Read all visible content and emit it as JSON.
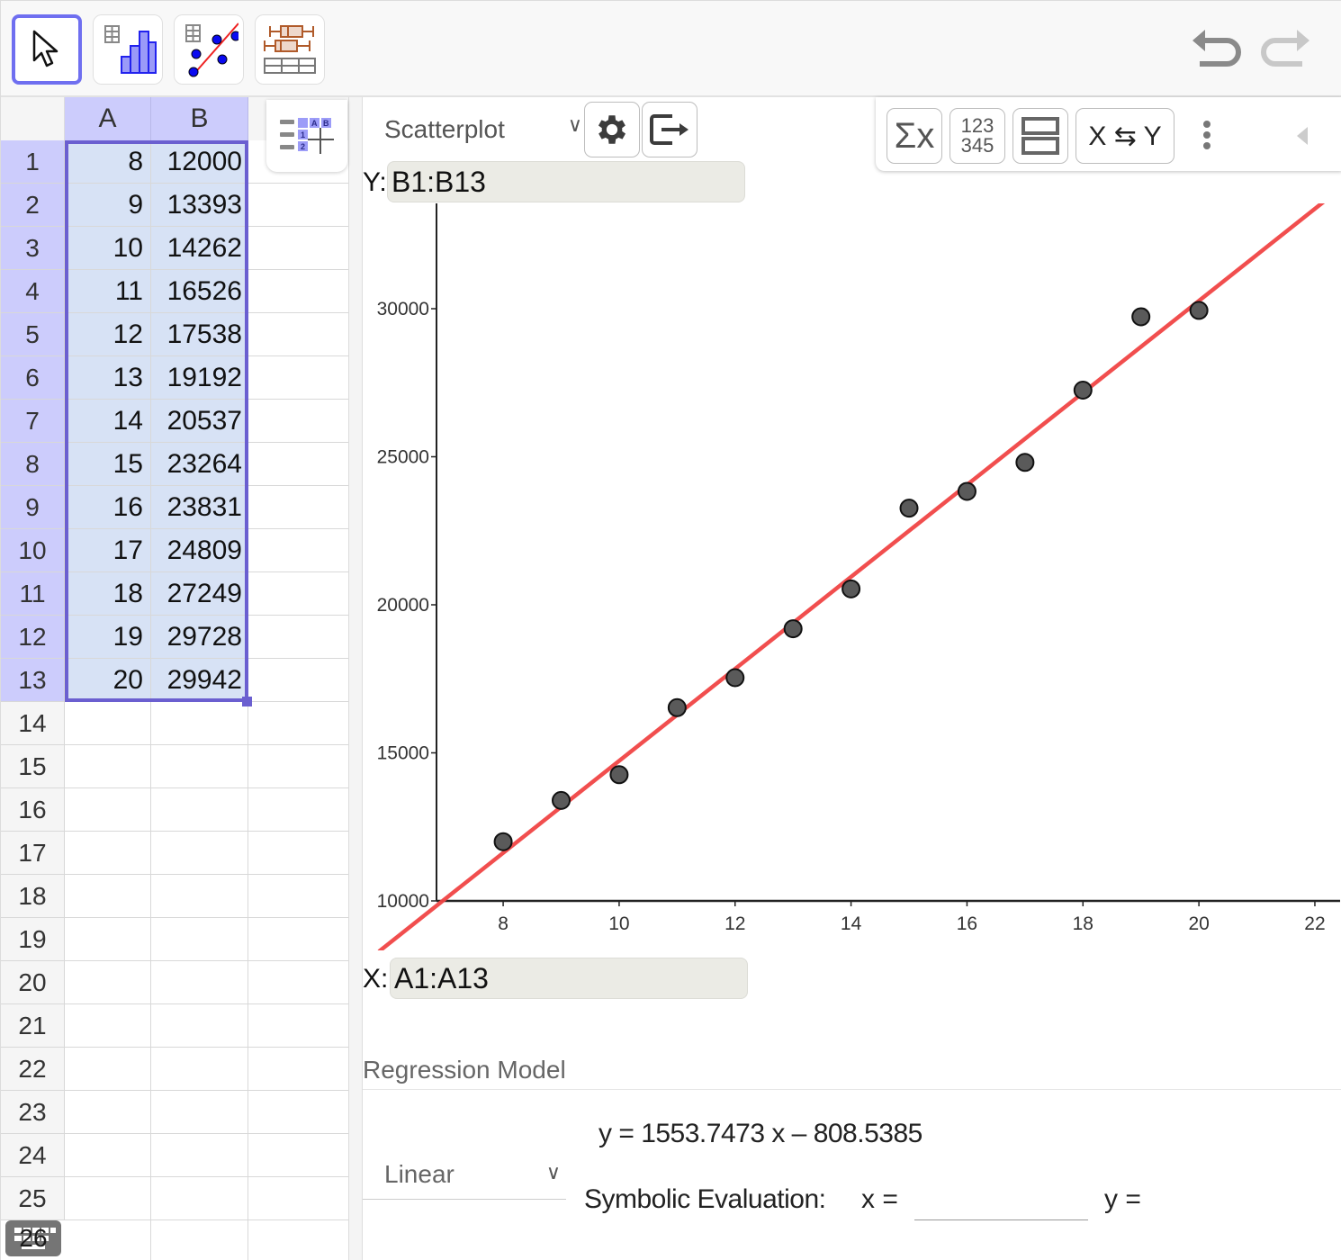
{
  "toolbar": {
    "tools": [
      {
        "name": "move-tool",
        "icon": "cursor-arrow-icon",
        "active": true
      },
      {
        "name": "one-variable-analysis",
        "icon": "histogram-icon",
        "active": false
      },
      {
        "name": "two-variable-regression-analysis",
        "icon": "scatter-regression-icon",
        "active": false
      },
      {
        "name": "multiple-variable-analysis",
        "icon": "boxplot-table-icon",
        "active": false
      }
    ],
    "undo": "undo-icon",
    "redo": "redo-icon"
  },
  "spreadsheet": {
    "columns": [
      "A",
      "B"
    ],
    "row_numbers": [
      "1",
      "2",
      "3",
      "4",
      "5",
      "6",
      "7",
      "8",
      "9",
      "10",
      "11",
      "12",
      "13",
      "14",
      "15",
      "16",
      "17",
      "18",
      "19",
      "20",
      "21",
      "22",
      "23",
      "24",
      "25",
      "26"
    ],
    "rows": [
      {
        "a": "8",
        "b": "12000"
      },
      {
        "a": "9",
        "b": "13393"
      },
      {
        "a": "10",
        "b": "14262"
      },
      {
        "a": "11",
        "b": "16526"
      },
      {
        "a": "12",
        "b": "17538"
      },
      {
        "a": "13",
        "b": "19192"
      },
      {
        "a": "14",
        "b": "20537"
      },
      {
        "a": "15",
        "b": "23264"
      },
      {
        "a": "16",
        "b": "23831"
      },
      {
        "a": "17",
        "b": "24809"
      },
      {
        "a": "18",
        "b": "27249"
      },
      {
        "a": "19",
        "b": "29728"
      },
      {
        "a": "20",
        "b": "29942"
      }
    ],
    "selected_range": "A1:B13",
    "selection_color": "#6b5fd0",
    "header_color": "#ccccfc"
  },
  "panel": {
    "plot_type": "Scatterplot",
    "settings_icon": "gear-icon",
    "export_icon": "export-icon",
    "stats_buttons": [
      {
        "name": "statistics",
        "label": "Σx"
      },
      {
        "name": "data-source",
        "label": "123\n345"
      },
      {
        "name": "layout",
        "label": "layout-icon"
      },
      {
        "name": "swap-xy",
        "label": "X ⇆ Y"
      }
    ],
    "more_icon": "more-vertical-icon",
    "collapse_icon": "triangle-left-icon",
    "y_label": "Y:",
    "y_range": "B1:B13",
    "x_label": "X:",
    "x_range": "A1:A13",
    "regression": {
      "title": "Regression Model",
      "type": "Linear",
      "equation": "y = 1553.7473 x – 808.5385",
      "symbolic_label": "Symbolic Evaluation:",
      "x_eq": "x =",
      "x_value": "",
      "y_eq": "y ="
    }
  },
  "chart_data": {
    "type": "scatter",
    "title": "",
    "xlabel": "",
    "ylabel": "",
    "x": [
      8,
      9,
      10,
      11,
      12,
      13,
      14,
      15,
      16,
      17,
      18,
      19,
      20
    ],
    "y": [
      12000,
      13393,
      14262,
      16526,
      17538,
      19192,
      20537,
      23264,
      23831,
      24809,
      27249,
      29728,
      29942
    ],
    "xlim": [
      6.85,
      22.3
    ],
    "ylim": [
      8500,
      33500
    ],
    "x_ticks": [
      8,
      10,
      12,
      14,
      16,
      18,
      20,
      22
    ],
    "y_ticks": [
      10000,
      15000,
      20000,
      25000,
      30000
    ],
    "x_axis_at_y": 10000,
    "y_axis_at_x": 6.85,
    "regression_line": {
      "slope": 1553.7473,
      "intercept": -808.5385,
      "color": "#f04545"
    },
    "point_color": "#5a5a5a",
    "grid": false
  }
}
